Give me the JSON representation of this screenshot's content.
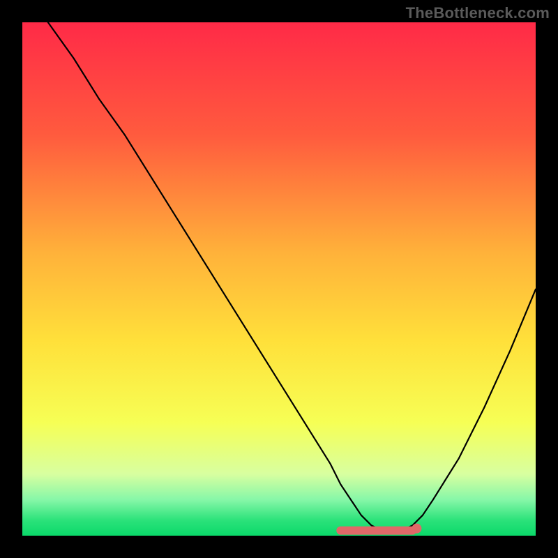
{
  "watermark": "TheBottleneck.com",
  "chart_data": {
    "type": "line",
    "title": "",
    "xlabel": "",
    "ylabel": "",
    "xlim": [
      0,
      100
    ],
    "ylim": [
      0,
      100
    ],
    "grid": false,
    "legend": false,
    "x": [
      5,
      10,
      15,
      20,
      25,
      30,
      35,
      40,
      45,
      50,
      55,
      60,
      62,
      64,
      66,
      68,
      70,
      72,
      74,
      76,
      78,
      80,
      85,
      90,
      95,
      100
    ],
    "values": [
      100,
      93,
      85,
      78,
      70,
      62,
      54,
      46,
      38,
      30,
      22,
      14,
      10,
      7,
      4,
      2,
      1,
      1,
      1,
      2,
      4,
      7,
      15,
      25,
      36,
      48
    ],
    "floor_marker": {
      "x_start": 62,
      "x_end": 76,
      "y": 1,
      "color": "#e06868"
    },
    "background_gradient": {
      "type": "vertical",
      "stops": [
        {
          "pos": 0.0,
          "color": "#ff2a47"
        },
        {
          "pos": 0.22,
          "color": "#ff5b3e"
        },
        {
          "pos": 0.45,
          "color": "#ffb23a"
        },
        {
          "pos": 0.62,
          "color": "#ffe03a"
        },
        {
          "pos": 0.78,
          "color": "#f6ff55"
        },
        {
          "pos": 0.88,
          "color": "#d8ffa0"
        },
        {
          "pos": 0.93,
          "color": "#86f7a8"
        },
        {
          "pos": 0.97,
          "color": "#2be27a"
        },
        {
          "pos": 1.0,
          "color": "#0bd96a"
        }
      ]
    }
  }
}
